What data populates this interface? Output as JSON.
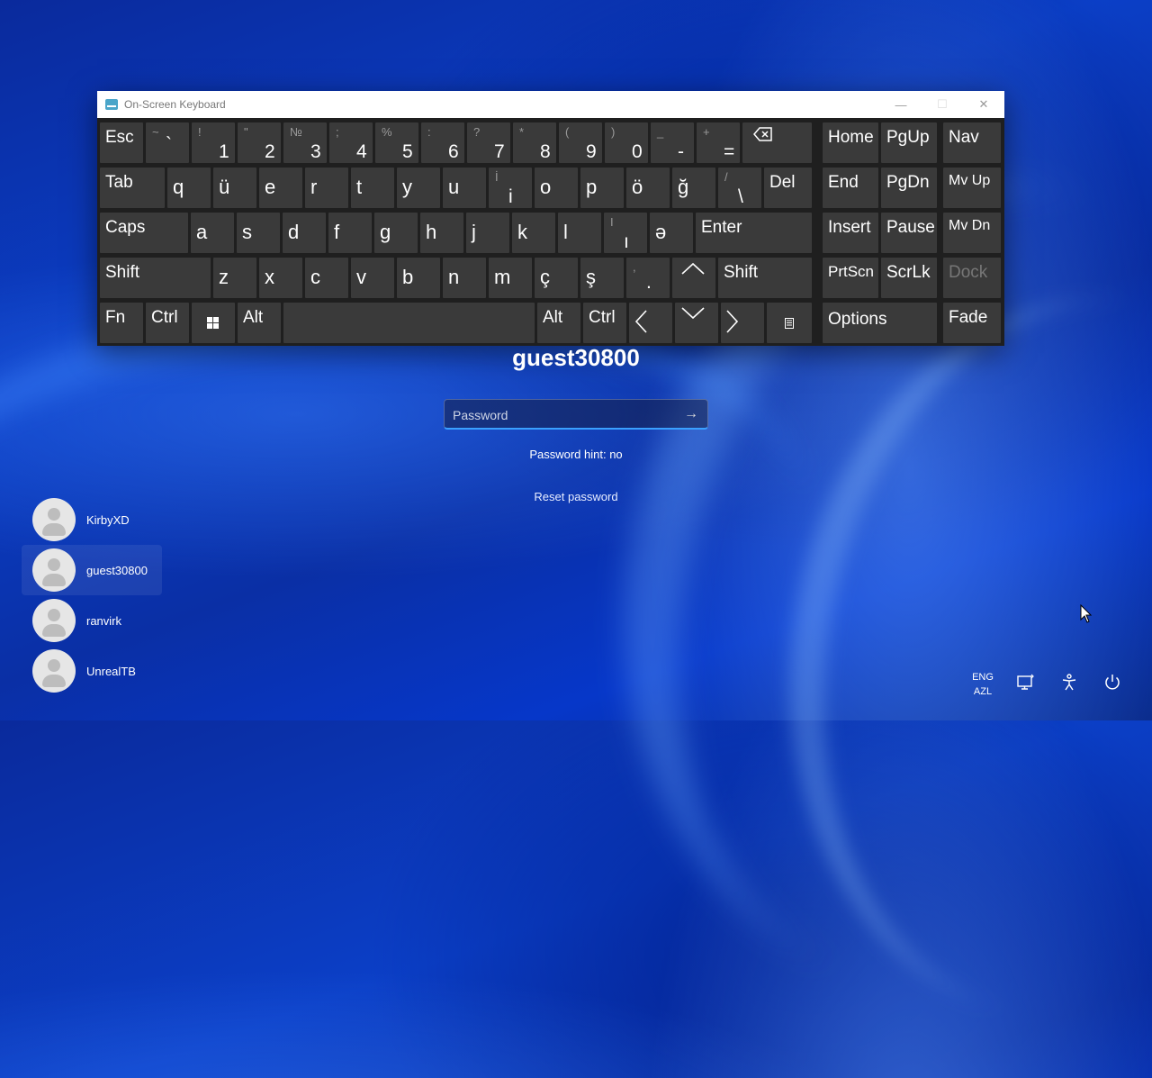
{
  "osk": {
    "title": "On-Screen Keyboard",
    "controls": {
      "minimize": "—",
      "maximize": "☐",
      "close": "✕"
    }
  },
  "keys": {
    "esc": "Esc",
    "num": [
      {
        "up": "~",
        "low": "`"
      },
      {
        "up": "!",
        "low": "1"
      },
      {
        "up": "\"",
        "low": "2"
      },
      {
        "up": "№",
        "low": "3"
      },
      {
        "up": ";",
        "low": "4"
      },
      {
        "up": "%",
        "low": "5"
      },
      {
        "up": ":",
        "low": "6"
      },
      {
        "up": "?",
        "low": "7"
      },
      {
        "up": "*",
        "low": "8"
      },
      {
        "up": "(",
        "low": "9"
      },
      {
        "up": ")",
        "low": "0"
      },
      {
        "up": "_",
        "low": "-"
      },
      {
        "up": "+",
        "low": "="
      }
    ],
    "tab": "Tab",
    "row_q": [
      "q",
      "ü",
      "e",
      "r",
      "t",
      "y",
      "u"
    ],
    "i_key": {
      "up": "İ",
      "low": "i"
    },
    "row_q2": [
      "o",
      "p",
      "ö",
      "ğ"
    ],
    "backslash": {
      "up": "/",
      "low": "\\"
    },
    "del": "Del",
    "caps": "Caps",
    "row_a": [
      "a",
      "s",
      "d",
      "f",
      "g",
      "h",
      "j",
      "k",
      "l"
    ],
    "i_dotless": {
      "up": "I",
      "low": "ı"
    },
    "schwa": "ə",
    "enter": "Enter",
    "shift": "Shift",
    "row_z": [
      "z",
      "x",
      "c",
      "v",
      "b",
      "n",
      "m",
      "ç",
      "ş"
    ],
    "comma_key": {
      "up": ",",
      "low": "."
    },
    "fn": "Fn",
    "ctrl": "Ctrl",
    "alt": "Alt",
    "nav": {
      "home": "Home",
      "pgup": "PgUp",
      "nav": "Nav",
      "end": "End",
      "pgdn": "PgDn",
      "mvup": "Mv Up",
      "insert": "Insert",
      "pause": "Pause",
      "mvdn": "Mv Dn",
      "prtscn": "PrtScn",
      "scrlk": "ScrLk",
      "dock": "Dock",
      "options": "Options",
      "fade": "Fade"
    }
  },
  "login": {
    "username": "guest30800",
    "password_placeholder": "Password",
    "hint": "Password hint: no",
    "reset": "Reset password"
  },
  "users": [
    "KirbyXD",
    "guest30800",
    "ranvirk",
    "UnrealTB"
  ],
  "tray": {
    "lang_top": "ENG",
    "lang_bottom": "AZL"
  }
}
